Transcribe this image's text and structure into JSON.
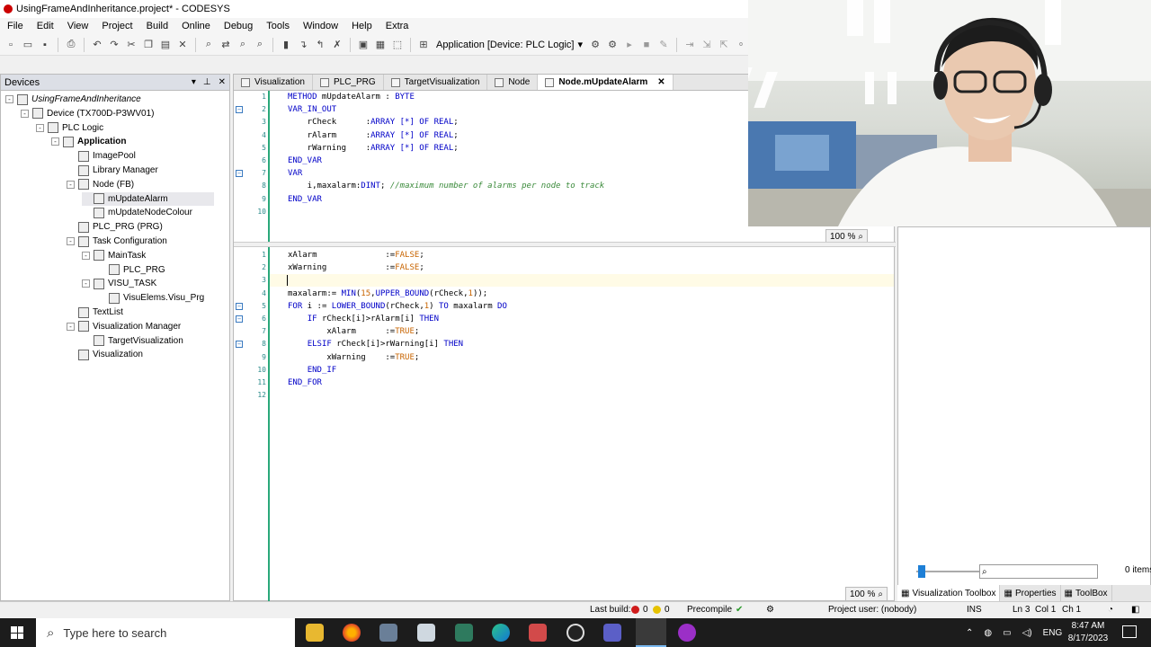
{
  "window": {
    "title": "UsingFrameAndInheritance.project* - CODESYS"
  },
  "menu": [
    "File",
    "Edit",
    "View",
    "Project",
    "Build",
    "Online",
    "Debug",
    "Tools",
    "Window",
    "Help",
    "Extra"
  ],
  "toolbar": {
    "active_application": "Application [Device: PLC Logic]"
  },
  "devices": {
    "title": "Devices",
    "tree": [
      {
        "label": "UsingFrameAndInheritance",
        "depth": 0,
        "expander": "-",
        "icon": "project-icon",
        "italic": true
      },
      {
        "label": "Device (TX700D-P3WV01)",
        "depth": 1,
        "expander": "-",
        "icon": "device-icon"
      },
      {
        "label": "PLC Logic",
        "depth": 2,
        "expander": "-",
        "icon": "plc-logic-icon"
      },
      {
        "label": "Application",
        "depth": 3,
        "expander": "-",
        "icon": "application-icon",
        "bold": true
      },
      {
        "label": "ImagePool",
        "depth": 4,
        "icon": "imagepool-icon"
      },
      {
        "label": "Library Manager",
        "depth": 4,
        "icon": "library-icon"
      },
      {
        "label": "Node (FB)",
        "depth": 4,
        "expander": "-",
        "icon": "fb-icon"
      },
      {
        "label": "mUpdateAlarm",
        "depth": 5,
        "icon": "method-icon",
        "selected": true
      },
      {
        "label": "mUpdateNodeColour",
        "depth": 5,
        "icon": "method-icon"
      },
      {
        "label": "PLC_PRG (PRG)",
        "depth": 4,
        "icon": "program-icon"
      },
      {
        "label": "Task Configuration",
        "depth": 4,
        "expander": "-",
        "icon": "task-config-icon"
      },
      {
        "label": "MainTask",
        "depth": 5,
        "expander": "-",
        "icon": "task-icon"
      },
      {
        "label": "PLC_PRG",
        "depth": 6,
        "icon": "program-call-icon"
      },
      {
        "label": "VISU_TASK",
        "depth": 5,
        "expander": "-",
        "icon": "task-icon"
      },
      {
        "label": "VisuElems.Visu_Prg",
        "depth": 6,
        "icon": "program-call-icon"
      },
      {
        "label": "TextList",
        "depth": 4,
        "icon": "textlist-icon"
      },
      {
        "label": "Visualization Manager",
        "depth": 4,
        "expander": "-",
        "icon": "visu-manager-icon"
      },
      {
        "label": "TargetVisualization",
        "depth": 5,
        "icon": "target-visu-icon"
      },
      {
        "label": "Visualization",
        "depth": 4,
        "icon": "visualization-icon"
      }
    ]
  },
  "editor": {
    "tabs": [
      {
        "label": "Visualization"
      },
      {
        "label": "PLC_PRG"
      },
      {
        "label": "TargetVisualization"
      },
      {
        "label": "Node"
      },
      {
        "label": "Node.mUpdateAlarm",
        "active": true,
        "close": "✕"
      }
    ],
    "declaration_lines": [
      [
        [
          "kw",
          "METHOD"
        ],
        [
          "t",
          " mUpdateAlarm : "
        ],
        [
          "kw",
          "BYTE"
        ]
      ],
      [
        [
          "kw",
          "VAR_IN_OUT"
        ]
      ],
      [
        [
          "t",
          "    rCheck      :"
        ],
        [
          "kw",
          "ARRAY [*] OF REAL"
        ],
        [
          "t",
          ";"
        ]
      ],
      [
        [
          "t",
          "    rAlarm      :"
        ],
        [
          "kw",
          "ARRAY [*] OF REAL"
        ],
        [
          "t",
          ";"
        ]
      ],
      [
        [
          "t",
          "    rWarning    :"
        ],
        [
          "kw",
          "ARRAY [*] OF REAL"
        ],
        [
          "t",
          ";"
        ]
      ],
      [
        [
          "kw",
          "END_VAR"
        ]
      ],
      [
        [
          "kw",
          "VAR"
        ]
      ],
      [
        [
          "t",
          "    i,maxalarm:"
        ],
        [
          "kw",
          "DINT"
        ],
        [
          "t",
          "; "
        ],
        [
          "cm",
          "//maximum number of alarms per node to track"
        ]
      ],
      [
        [
          "kw",
          "END_VAR"
        ]
      ],
      []
    ],
    "body_lines": [
      [
        [
          "t",
          "xAlarm              :="
        ],
        [
          "lit",
          "FALSE"
        ],
        [
          "t",
          ";"
        ]
      ],
      [
        [
          "t",
          "xWarning            :="
        ],
        [
          "lit",
          "FALSE"
        ],
        [
          "t",
          ";"
        ]
      ],
      [],
      [
        [
          "t",
          "maxalarm:= "
        ],
        [
          "kw",
          "MIN"
        ],
        [
          "t",
          "("
        ],
        [
          "lit",
          "15"
        ],
        [
          "t",
          ","
        ],
        [
          "kw",
          "UPPER_BOUND"
        ],
        [
          "t",
          "(rCheck,"
        ],
        [
          "lit",
          "1"
        ],
        [
          "t",
          "));"
        ]
      ],
      [
        [
          "kw",
          "FOR"
        ],
        [
          "t",
          " i := "
        ],
        [
          "kw",
          "LOWER_BOUND"
        ],
        [
          "t",
          "(rCheck,"
        ],
        [
          "lit",
          "1"
        ],
        [
          "t",
          ") "
        ],
        [
          "kw",
          "TO"
        ],
        [
          "t",
          " maxalarm "
        ],
        [
          "kw",
          "DO"
        ]
      ],
      [
        [
          "t",
          "    "
        ],
        [
          "kw",
          "IF"
        ],
        [
          "t",
          " rCheck[i]>rAlarm[i] "
        ],
        [
          "kw",
          "THEN"
        ]
      ],
      [
        [
          "t",
          "        xAlarm      :="
        ],
        [
          "lit",
          "TRUE"
        ],
        [
          "t",
          ";"
        ]
      ],
      [
        [
          "t",
          "    "
        ],
        [
          "kw",
          "ELSIF"
        ],
        [
          "t",
          " rCheck[i]>rWarning[i] "
        ],
        [
          "kw",
          "THEN"
        ]
      ],
      [
        [
          "t",
          "        xWarning    :="
        ],
        [
          "lit",
          "TRUE"
        ],
        [
          "t",
          ";"
        ]
      ],
      [
        [
          "t",
          "    "
        ],
        [
          "kw",
          "END_IF"
        ]
      ],
      [
        [
          "kw",
          "END_FOR"
        ]
      ],
      []
    ],
    "zoom_top": "100 %",
    "zoom_bottom": "100 %"
  },
  "toolbox": {
    "count": "0 items",
    "tabs": [
      "Visualization Toolbox",
      "Properties",
      "ToolBox"
    ]
  },
  "status": {
    "last_build_label": "Last build:",
    "errors": "0",
    "warnings": "0",
    "precompile": "Precompile",
    "project_user": "Project user: (nobody)",
    "ins": "INS",
    "ln": "Ln 3",
    "col": "Col 1",
    "ch": "Ch 1"
  },
  "taskbar": {
    "search_placeholder": "Type here to search",
    "lang": "ENG",
    "time": "8:47 AM",
    "date": "8/17/2023"
  },
  "colors": {
    "keyword": "#0000c8",
    "comment": "#3a8a3a",
    "literal": "#c86400",
    "line_number": "#2a8a8a",
    "gutter": "#2aa87a",
    "accent": "#1e7fd6"
  }
}
